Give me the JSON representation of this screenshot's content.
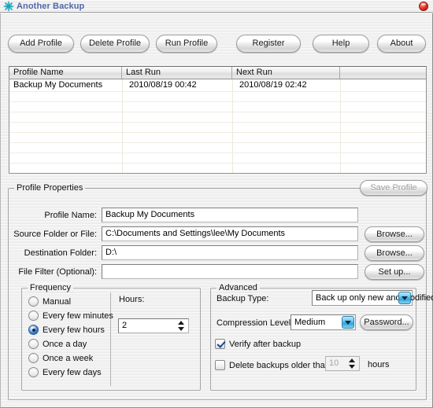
{
  "window": {
    "title": "Another Backup",
    "icon": "snowflake-icon",
    "close_label": "",
    "accent_blue": "#5566aa",
    "close_color": "#ef4237"
  },
  "toolbar": {
    "left_buttons": [
      {
        "id": "add-profile",
        "label": "Add Profile"
      },
      {
        "id": "delete-profile",
        "label": "Delete Profile"
      },
      {
        "id": "run-profile",
        "label": "Run Profile"
      }
    ],
    "right_buttons": [
      {
        "id": "register",
        "label": "Register"
      },
      {
        "id": "help",
        "label": "Help"
      },
      {
        "id": "about",
        "label": "About"
      }
    ]
  },
  "profile_list": {
    "columns": [
      "Profile Name",
      "Last Run",
      "Next Run",
      ""
    ],
    "rows": [
      [
        "Backup My Documents",
        "2010/08/19 00:42",
        "2010/08/19 02:42",
        ""
      ]
    ],
    "empty_row_count": 8
  },
  "profile_properties": {
    "group_label": "Profile Properties",
    "save_button": {
      "label": "Save Profile",
      "enabled": false
    },
    "fields": [
      {
        "id": "profile-name",
        "label": "Profile Name:",
        "value": "Backup My Documents",
        "button": null
      },
      {
        "id": "source-folder",
        "label": "Source Folder or File:",
        "value": "C:\\Documents and Settings\\lee\\My Documents",
        "button": "Browse..."
      },
      {
        "id": "destination-folder",
        "label": "Destination Folder:",
        "value": "D:\\",
        "button": "Browse..."
      },
      {
        "id": "file-filter",
        "label": "File Filter (Optional):",
        "value": "",
        "button": "Set up..."
      }
    ]
  },
  "frequency": {
    "group_label": "Frequency",
    "options": [
      {
        "id": "manual",
        "label": "Manual",
        "selected": false
      },
      {
        "id": "every-few-minutes",
        "label": "Every few minutes",
        "selected": false
      },
      {
        "id": "every-few-hours",
        "label": "Every few hours",
        "selected": true
      },
      {
        "id": "once-a-day",
        "label": "Once a day",
        "selected": false
      },
      {
        "id": "once-a-week",
        "label": "Once a week",
        "selected": false
      },
      {
        "id": "every-few-days",
        "label": "Every few days",
        "selected": false
      }
    ],
    "interval": {
      "label": "Hours:",
      "value": "2"
    }
  },
  "advanced": {
    "group_label": "Advanced",
    "backup_type": {
      "label": "Backup Type:",
      "value": "Back up only new and modified files"
    },
    "compression_level": {
      "label": "Compression Level:",
      "value": "Medium"
    },
    "password_button": "Password...",
    "verify": {
      "label": "Verify after backup",
      "checked": true
    },
    "delete_old": {
      "label": "Delete backups older than",
      "checked": false,
      "value": "10",
      "unit": "hours"
    }
  }
}
